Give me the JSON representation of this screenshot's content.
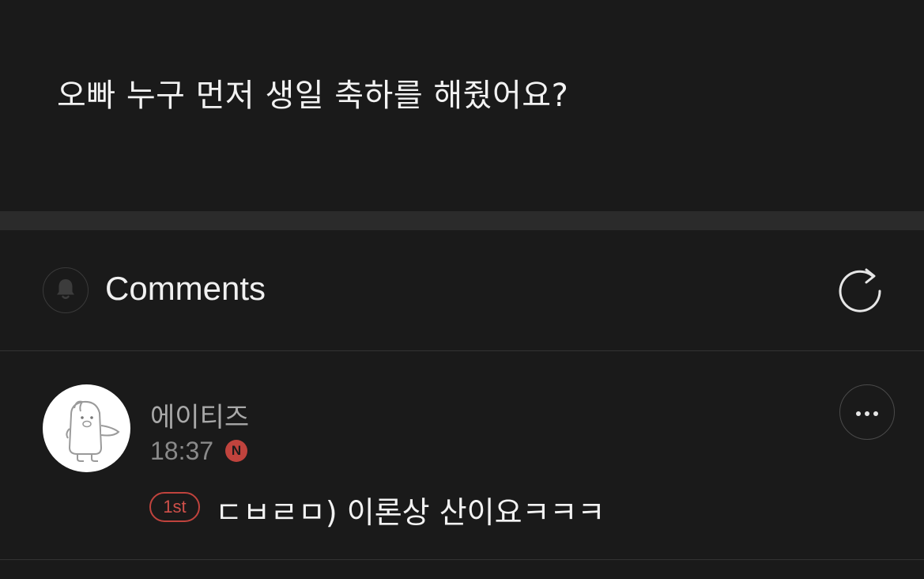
{
  "post": {
    "text": "오빠 누구 먼저 생일 축하를 해줬어요?"
  },
  "comments_section": {
    "title": "Comments",
    "bell_icon": "bell-icon",
    "refresh_icon": "refresh-icon"
  },
  "comments": [
    {
      "author": "에이티즈",
      "time": "18:37",
      "new_badge": "N",
      "rank_badge": "1st",
      "text": "ㄷㅂㄹㅁ) 이론상 산이요ㅋㅋㅋ",
      "more_icon": "more-icon"
    }
  ],
  "colors": {
    "background": "#1a1a1a",
    "divider": "#2b2b2b",
    "accent_red": "#c0433d",
    "text_primary": "#f2f2f2",
    "text_secondary": "#a8a8a8"
  }
}
